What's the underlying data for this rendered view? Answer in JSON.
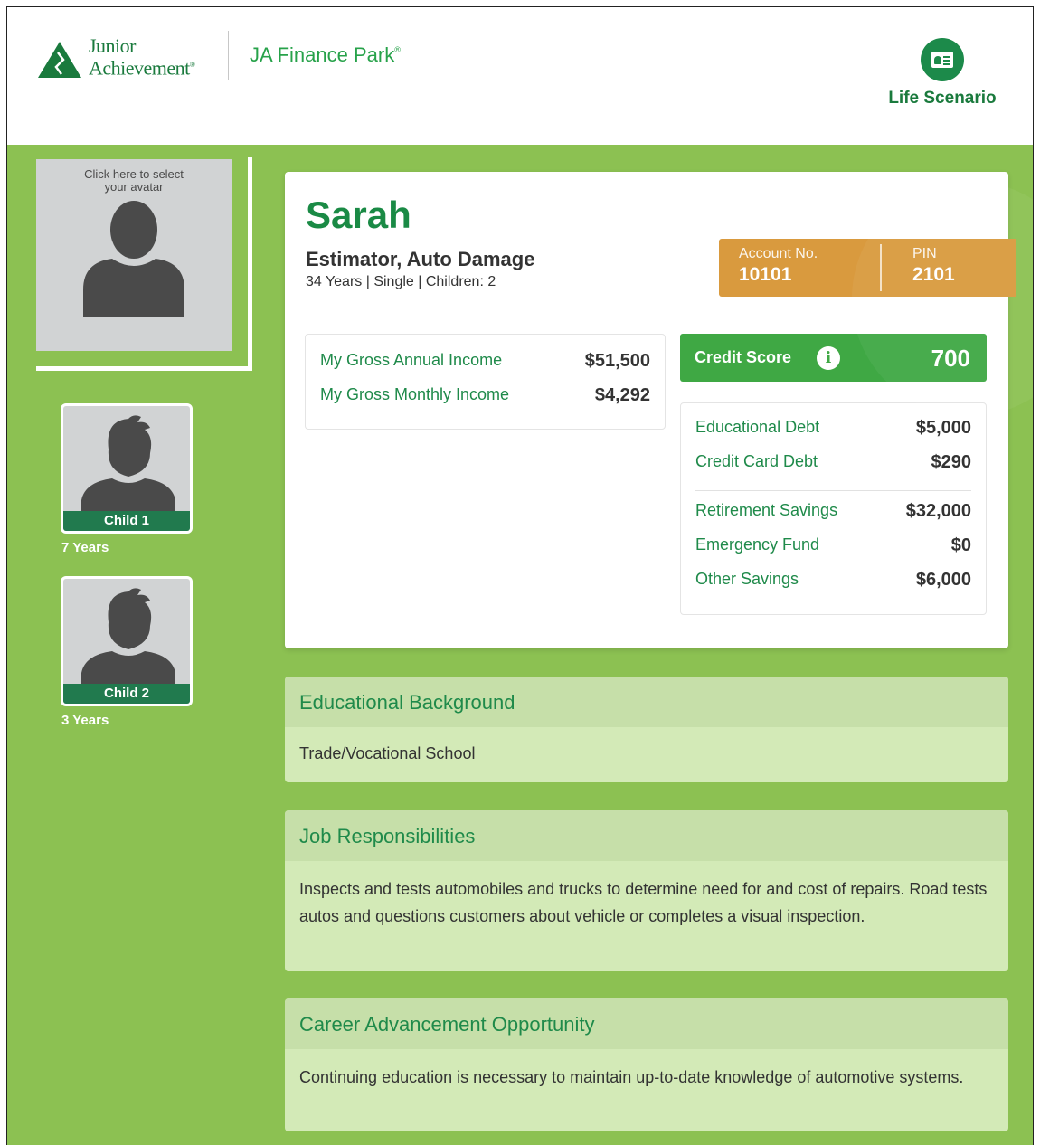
{
  "header": {
    "logo_line1": "Junior",
    "logo_line2": "Achievement",
    "logo_mark": "®",
    "product": "JA Finance Park",
    "product_mark": "®",
    "life_scenario": {
      "icon": "id-card-icon",
      "label": "Life Scenario"
    }
  },
  "avatar": {
    "hint": "Click here to select your avatar",
    "icon": "person-silhouette-icon"
  },
  "children": [
    {
      "label": "Child 1",
      "age": "7 Years"
    },
    {
      "label": "Child 2",
      "age": "3 Years"
    }
  ],
  "profile": {
    "name": "Sarah",
    "job": "Estimator, Auto Damage",
    "meta": "34 Years | Single | Children: 2",
    "account_label": "Account No.",
    "account_value": "10101",
    "pin_label": "PIN",
    "pin_value": "2101"
  },
  "income": [
    {
      "label": "My Gross Annual Income",
      "value": "$51,500"
    },
    {
      "label": "My Gross Monthly Income",
      "value": "$4,292"
    }
  ],
  "credit": {
    "label": "Credit Score",
    "info_glyph": "i",
    "value": "700"
  },
  "debts": [
    {
      "label": "Educational Debt",
      "value": "$5,000"
    },
    {
      "label": "Credit Card Debt",
      "value": "$290"
    }
  ],
  "savings": [
    {
      "label": "Retirement Savings",
      "value": "$32,000"
    },
    {
      "label": "Emergency Fund",
      "value": "$0"
    },
    {
      "label": "Other Savings",
      "value": "$6,000"
    }
  ],
  "panels": [
    {
      "title": "Educational Background",
      "body": "Trade/Vocational School"
    },
    {
      "title": "Job Responsibilities",
      "body": "Inspects and tests automobiles and trucks to determine need for and cost of repairs. Road tests autos and questions customers about vehicle or completes a visual inspection."
    },
    {
      "title": "Career Advancement Opportunity",
      "body": "Continuing education is necessary to maintain up-to-date knowledge of automotive systems."
    }
  ],
  "colors": {
    "brand_green": "#1a7a3d",
    "background_green": "#8cc152",
    "credit_green": "#3fa844",
    "account_orange": "#d99a3e"
  }
}
